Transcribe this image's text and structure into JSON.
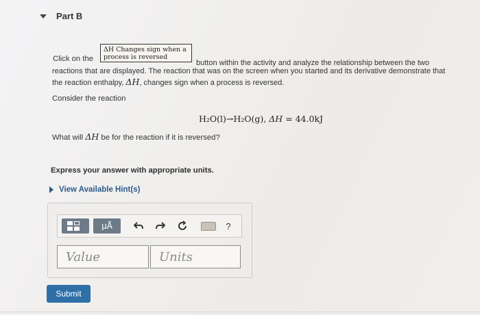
{
  "part": {
    "title": "Part B"
  },
  "activity_button": {
    "line1": "ΔH Changes sign when a",
    "line2": "process is reversed"
  },
  "instructions": {
    "l1_pre": "Click on the",
    "l1_post": "button within the activity and analyze the relationship between the two",
    "l2": "reactions that are displayed. The reaction that was on the screen when you started and its derivative demonstrate that",
    "l3_pre": "the reaction enthalpy, ",
    "l3_sym": "ΔH",
    "l3_post": ", changes sign when a process is reversed."
  },
  "consider": "Consider the reaction",
  "reaction": {
    "lhs": "H₂O(l)→H₂O(g), ",
    "dh": "ΔH",
    "rhs": " = 44.0kJ"
  },
  "question": {
    "pre": "What will ",
    "sym": "ΔH",
    "post": " be for the reaction if it is reversed?"
  },
  "express": "Express your answer with appropriate units.",
  "hint_label": "View Available Hint(s)",
  "toolbar": {
    "templates_icon": "templates-icon",
    "units_label": "μÅ",
    "undo_icon": "undo-icon",
    "redo_icon": "redo-icon",
    "reset_icon": "reset-icon",
    "keyboard_icon": "keyboard-icon",
    "help_label": "?"
  },
  "answer": {
    "value_placeholder": "Value",
    "units_placeholder": "Units"
  },
  "submit_label": "Submit"
}
